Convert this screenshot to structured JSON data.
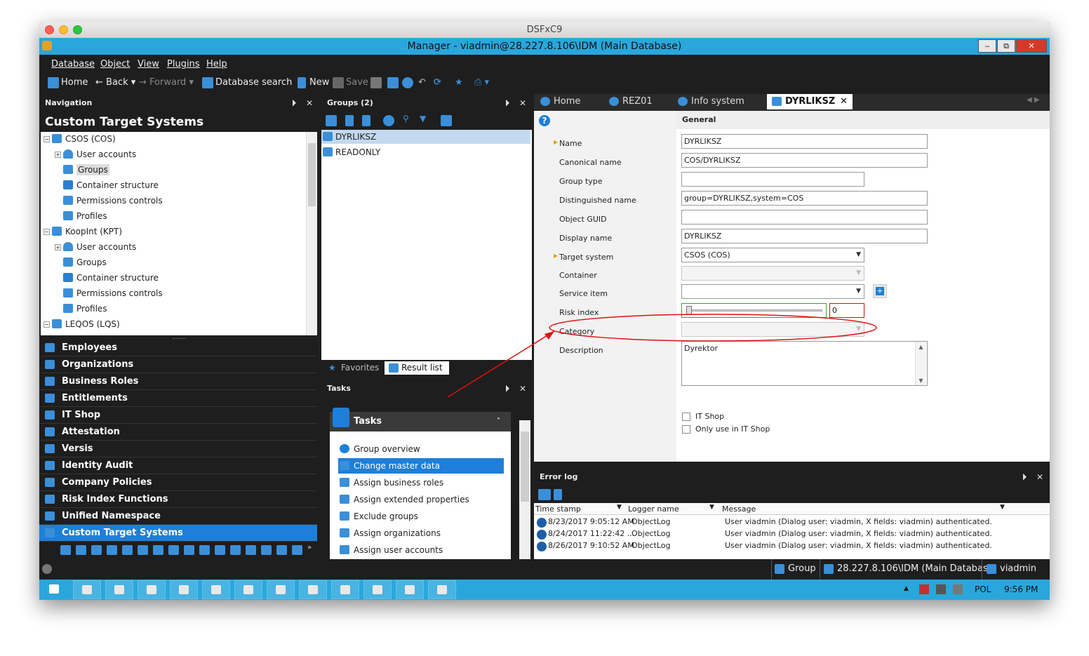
{
  "mac_title": "DSFxC9",
  "window_title": "Manager - viadmin@28.227.8.106\\IDM (Main Database)",
  "window_buttons": [
    "‒",
    "⧉",
    "✕"
  ],
  "menu": [
    "Database",
    "Object",
    "View",
    "Plugins",
    "Help"
  ],
  "toolbar": {
    "home": "Home",
    "back": "Back",
    "forward": "Forward",
    "db_search": "Database search",
    "new": "New",
    "save": "Save"
  },
  "navigation": {
    "header": "Navigation",
    "title": "Custom Target Systems",
    "tree": [
      {
        "label": "CSOS (COS)",
        "level": 0,
        "icon": "target-system-icon"
      },
      {
        "label": "User accounts",
        "level": 1,
        "icon": "user-icon"
      },
      {
        "label": "Groups",
        "level": 1,
        "icon": "group-icon",
        "selected": true
      },
      {
        "label": "Container structure",
        "level": 1,
        "icon": "folder-icon"
      },
      {
        "label": "Permissions controls",
        "level": 1,
        "icon": "key-icon"
      },
      {
        "label": "Profiles",
        "level": 1,
        "icon": "profile-icon"
      },
      {
        "label": "KoopInt (KPT)",
        "level": 0,
        "icon": "target-system-icon"
      },
      {
        "label": "User accounts",
        "level": 1,
        "icon": "user-icon"
      },
      {
        "label": "Groups",
        "level": 1,
        "icon": "group-icon"
      },
      {
        "label": "Container structure",
        "level": 1,
        "icon": "folder-icon"
      },
      {
        "label": "Permissions controls",
        "level": 1,
        "icon": "key-icon"
      },
      {
        "label": "Profiles",
        "level": 1,
        "icon": "profile-icon"
      },
      {
        "label": "LEQOS (LQS)",
        "level": 0,
        "icon": "target-system-icon"
      }
    ],
    "nav_items": [
      "Employees",
      "Organizations",
      "Business Roles",
      "Entitlements",
      "IT Shop",
      "Attestation",
      "Versis",
      "Identity Audit",
      "Company Policies",
      "Risk Index Functions",
      "Unified Namespace",
      "Custom Target Systems"
    ],
    "active_item": "Custom Target Systems"
  },
  "groups": {
    "header": "Groups (2)",
    "items": [
      "DYRLIKSZ",
      "READONLY"
    ],
    "tabs": [
      "Favorites",
      "Result list"
    ]
  },
  "tasks": {
    "header": "Tasks",
    "title": "Tasks",
    "items": [
      "Group overview",
      "Change master data",
      "Assign business roles",
      "Assign extended properties",
      "Exclude groups",
      "Assign organizations",
      "Assign user accounts"
    ],
    "active": "Change master data"
  },
  "tabs": [
    "Home",
    "REZ01",
    "Info system",
    "DYRLIKSZ"
  ],
  "form": {
    "section": "General",
    "labels": {
      "name": "Name",
      "canonical": "Canonical name",
      "group_type": "Group type",
      "dn": "Distinguished name",
      "guid": "Object GUID",
      "display": "Display name",
      "target": "Target system",
      "container": "Container",
      "service": "Service item",
      "risk": "Risk index",
      "category": "Category",
      "description": "Description",
      "itshop": "IT Shop",
      "only_itshop": "Only use in IT Shop"
    },
    "values": {
      "name": "DYRLIKSZ",
      "canonical": "COS/DYRLIKSZ",
      "group_type": "",
      "dn": "group=DYRLIKSZ,system=COS",
      "guid": "",
      "display": "DYRLIKSZ",
      "target": "CSOS (COS)",
      "container": "",
      "service": "",
      "risk": "0",
      "category": "",
      "description": "Dyrektor"
    },
    "risk_level": 0
  },
  "errorlog": {
    "header": "Error log",
    "columns": [
      "Time stamp",
      "Logger name",
      "Message"
    ],
    "rows": [
      {
        "time": "8/23/2017 9:05:12 AM",
        "logger": "ObjectLog",
        "message": "User viadmin (Dialog user: viadmin, X fields: viadmin) authenticated."
      },
      {
        "time": "8/24/2017 11:22:42 ...",
        "logger": "ObjectLog",
        "message": "User viadmin (Dialog user: viadmin, X fields: viadmin) authenticated."
      },
      {
        "time": "8/26/2017 9:10:52 AM",
        "logger": "ObjectLog",
        "message": "User viadmin (Dialog user: viadmin, X fields: viadmin) authenticated."
      }
    ]
  },
  "statusbar": {
    "object": "Group",
    "db": "28.227.8.106\\IDM (Main Database)",
    "user": "viadmin"
  },
  "taskbar": {
    "lang": "POL",
    "time": "9:56 PM"
  },
  "colors": {
    "accent": "#29a7dc",
    "selection": "#1e7fd8",
    "annotation": "#e01010"
  }
}
